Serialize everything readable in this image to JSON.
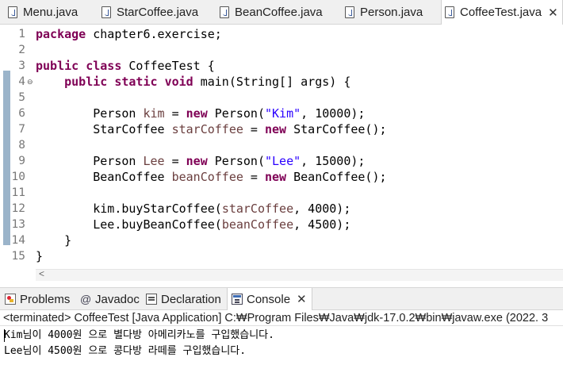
{
  "editor_tabs": [
    {
      "label": "Menu.java",
      "active": false
    },
    {
      "label": "StarCoffee.java",
      "active": false
    },
    {
      "label": "BeanCoffee.java",
      "active": false
    },
    {
      "label": "Person.java",
      "active": false
    },
    {
      "label": "CoffeeTest.java",
      "active": true,
      "close": "✕"
    }
  ],
  "code_lines": [
    {
      "n": "1",
      "parts": [
        {
          "t": "package",
          "c": "kw"
        },
        {
          "t": " chapter6.exercise;"
        }
      ]
    },
    {
      "n": "2",
      "parts": []
    },
    {
      "n": "3",
      "parts": [
        {
          "t": "public",
          "c": "kw"
        },
        {
          "t": " "
        },
        {
          "t": "class",
          "c": "kw"
        },
        {
          "t": " CoffeeTest {"
        }
      ]
    },
    {
      "n": "4",
      "fold": "⊖",
      "parts": [
        {
          "t": "    "
        },
        {
          "t": "public",
          "c": "kw"
        },
        {
          "t": " "
        },
        {
          "t": "static",
          "c": "kw"
        },
        {
          "t": " "
        },
        {
          "t": "void",
          "c": "kw"
        },
        {
          "t": " main(String[] args) {"
        }
      ]
    },
    {
      "n": "5",
      "parts": []
    },
    {
      "n": "6",
      "parts": [
        {
          "t": "        Person "
        },
        {
          "t": "kim",
          "c": "var"
        },
        {
          "t": " = "
        },
        {
          "t": "new",
          "c": "kw"
        },
        {
          "t": " Person("
        },
        {
          "t": "\"Kim\"",
          "c": "str"
        },
        {
          "t": ", 10000);"
        }
      ]
    },
    {
      "n": "7",
      "parts": [
        {
          "t": "        StarCoffee "
        },
        {
          "t": "starCoffee",
          "c": "var"
        },
        {
          "t": " = "
        },
        {
          "t": "new",
          "c": "kw"
        },
        {
          "t": " StarCoffee();"
        }
      ]
    },
    {
      "n": "8",
      "parts": []
    },
    {
      "n": "9",
      "parts": [
        {
          "t": "        Person "
        },
        {
          "t": "Lee",
          "c": "var"
        },
        {
          "t": " = "
        },
        {
          "t": "new",
          "c": "kw"
        },
        {
          "t": " Person("
        },
        {
          "t": "\"Lee\"",
          "c": "str"
        },
        {
          "t": ", 15000);"
        }
      ]
    },
    {
      "n": "10",
      "parts": [
        {
          "t": "        BeanCoffee "
        },
        {
          "t": "beanCoffee",
          "c": "var"
        },
        {
          "t": " = "
        },
        {
          "t": "new",
          "c": "kw"
        },
        {
          "t": " BeanCoffee();"
        }
      ]
    },
    {
      "n": "11",
      "parts": []
    },
    {
      "n": "12",
      "parts": [
        {
          "t": "        kim.buyStarCoffee("
        },
        {
          "t": "starCoffee",
          "c": "var"
        },
        {
          "t": ", 4000);"
        }
      ]
    },
    {
      "n": "13",
      "parts": [
        {
          "t": "        Lee.buyBeanCoffee("
        },
        {
          "t": "beanCoffee",
          "c": "var"
        },
        {
          "t": ", 4500);"
        }
      ]
    },
    {
      "n": "14",
      "parts": [
        {
          "t": "    }"
        }
      ]
    },
    {
      "n": "15",
      "parts": [
        {
          "t": "}"
        }
      ]
    }
  ],
  "panel_tabs": [
    {
      "label": "Problems",
      "icon": "problems-icon",
      "active": false
    },
    {
      "label": "Javadoc",
      "icon": "javadoc-icon",
      "glyph": "@",
      "active": false
    },
    {
      "label": "Declaration",
      "icon": "declaration-icon",
      "active": false
    },
    {
      "label": "Console",
      "icon": "console-icon",
      "active": true,
      "close": "✕"
    }
  ],
  "console": {
    "status": "<terminated> CoffeeTest [Java Application] C:₩Program Files₩Java₩jdk-17.0.2₩bin₩javaw.exe  (2022. 3",
    "output": [
      "Kim님이 4000원 으로 별다방 아메리카노를 구입했습니다.",
      "Lee님이 4500원 으로 콩다방 라떼를 구입했습니다."
    ]
  },
  "colors": {
    "keyword": "#7f0055",
    "string": "#2a00ff",
    "variable": "#6a3e3e",
    "line_number": "#787878"
  }
}
